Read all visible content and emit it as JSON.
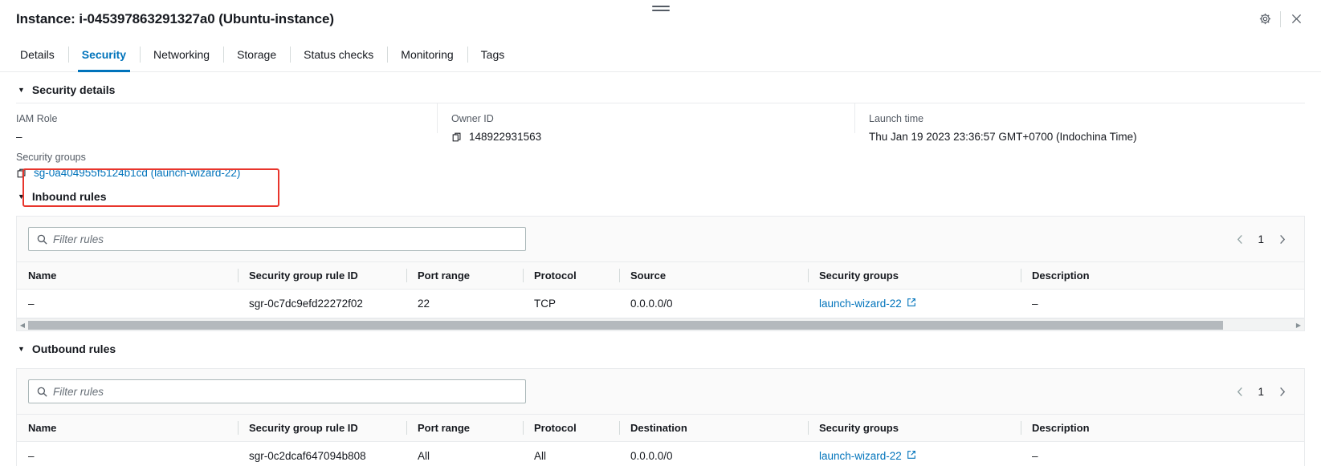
{
  "header": {
    "title": "Instance: i-045397863291327a0 (Ubuntu-instance)",
    "settings_icon": "gear-icon",
    "close_icon": "close-icon",
    "drag_handle": "drag-handle"
  },
  "tabs": [
    {
      "label": "Details",
      "active": false
    },
    {
      "label": "Security",
      "active": true
    },
    {
      "label": "Networking",
      "active": false
    },
    {
      "label": "Storage",
      "active": false
    },
    {
      "label": "Status checks",
      "active": false
    },
    {
      "label": "Monitoring",
      "active": false
    },
    {
      "label": "Tags",
      "active": false
    }
  ],
  "security_details": {
    "heading": "Security details",
    "iam_role": {
      "label": "IAM Role",
      "value": "–"
    },
    "owner_id": {
      "label": "Owner ID",
      "value": "148922931563",
      "icon": "copy-icon"
    },
    "launch_time": {
      "label": "Launch time",
      "value": "Thu Jan 19 2023 23:36:57 GMT+0700 (Indochina Time)"
    },
    "security_groups": {
      "label": "Security groups",
      "value": "sg-0a404955f5124b1cd (launch-wizard-22)",
      "icon": "copy-icon",
      "highlight_color": "#e8352c"
    }
  },
  "inbound": {
    "heading": "Inbound rules",
    "filter_placeholder": "Filter rules",
    "search_icon": "search-icon",
    "pagination": {
      "prev": "chevron-left-icon",
      "page": "1",
      "next": "chevron-right-icon"
    },
    "columns": [
      "Name",
      "Security group rule ID",
      "Port range",
      "Protocol",
      "Source",
      "Security groups",
      "Description"
    ],
    "rows": [
      {
        "name": "–",
        "rule_id": "sgr-0c7dc9efd22272f02",
        "port_range": "22",
        "protocol": "TCP",
        "source": "0.0.0.0/0",
        "security_groups": "launch-wizard-22",
        "security_groups_icon": "external-link-icon",
        "description": "–"
      }
    ]
  },
  "outbound": {
    "heading": "Outbound rules",
    "filter_placeholder": "Filter rules",
    "search_icon": "search-icon",
    "pagination": {
      "prev": "chevron-left-icon",
      "page": "1",
      "next": "chevron-right-icon"
    },
    "columns": [
      "Name",
      "Security group rule ID",
      "Port range",
      "Protocol",
      "Destination",
      "Security groups",
      "Description"
    ],
    "rows": [
      {
        "name": "–",
        "rule_id": "sgr-0c2dcaf647094b808",
        "port_range": "All",
        "protocol": "All",
        "destination": "0.0.0.0/0",
        "security_groups": "launch-wizard-22",
        "security_groups_icon": "external-link-icon",
        "description": "–"
      }
    ]
  },
  "colors": {
    "link": "#0073bb",
    "accent": "#0073bb",
    "highlight": "#e8352c",
    "label": "#545b64"
  }
}
